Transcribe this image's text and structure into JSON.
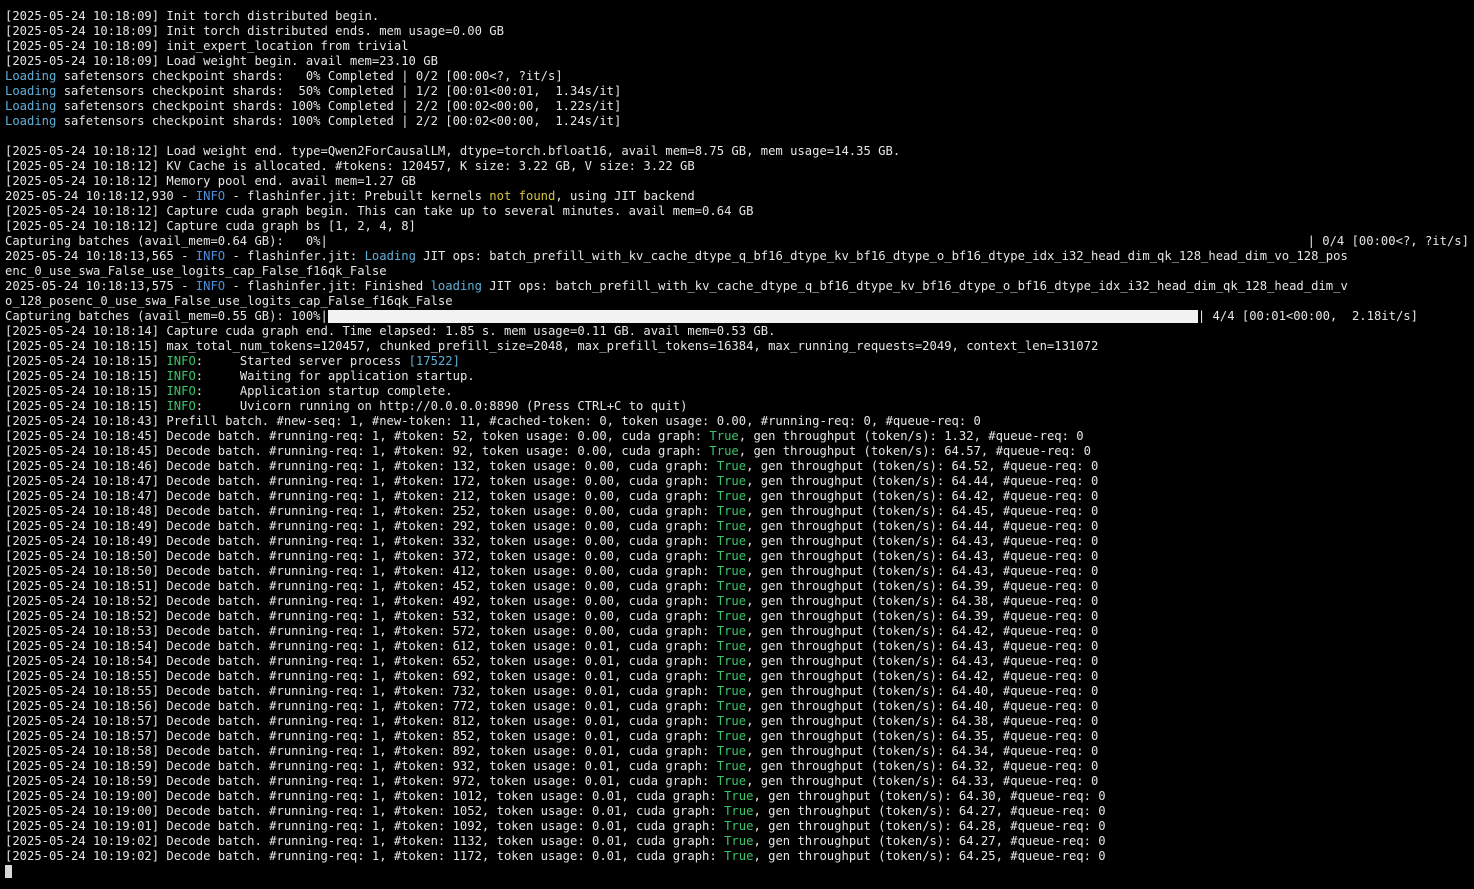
{
  "terminal": {
    "lines": [
      {
        "type": "text",
        "segs": [
          [
            "[2025-05-24 10:18:09] Init torch distributed begin.",
            ""
          ]
        ]
      },
      {
        "type": "text",
        "segs": [
          [
            "[2025-05-24 10:18:09] Init torch distributed ends. mem usage=0.00 GB",
            ""
          ]
        ]
      },
      {
        "type": "text",
        "segs": [
          [
            "[2025-05-24 10:18:09] init_expert_location from trivial",
            ""
          ]
        ]
      },
      {
        "type": "text",
        "segs": [
          [
            "[2025-05-24 10:18:09] Load weight begin. avail mem=23.10 GB",
            ""
          ]
        ]
      },
      {
        "type": "text",
        "segs": [
          [
            "Loading",
            "blue"
          ],
          [
            " safetensors checkpoint shards:   0% Completed | 0/2 [00:00<?, ?it/s]",
            ""
          ]
        ]
      },
      {
        "type": "text",
        "segs": [
          [
            "Loading",
            "blue"
          ],
          [
            " safetensors checkpoint shards:  50% Completed | 1/2 [00:01<00:01,  1.34s/it]",
            ""
          ]
        ]
      },
      {
        "type": "text",
        "segs": [
          [
            "Loading",
            "blue"
          ],
          [
            " safetensors checkpoint shards: 100% Completed | 2/2 [00:02<00:00,  1.22s/it]",
            ""
          ]
        ]
      },
      {
        "type": "text",
        "segs": [
          [
            "Loading",
            "blue"
          ],
          [
            " safetensors checkpoint shards: 100% Completed | 2/2 [00:02<00:00,  1.24s/it]",
            ""
          ]
        ]
      },
      {
        "type": "text",
        "segs": [
          [
            "",
            ""
          ]
        ]
      },
      {
        "type": "text",
        "segs": [
          [
            "[2025-05-24 10:18:12] Load weight end. type=Qwen2ForCausalLM, dtype=torch.bfloat16, avail mem=8.75 GB, mem usage=14.35 GB.",
            ""
          ]
        ]
      },
      {
        "type": "text",
        "segs": [
          [
            "[2025-05-24 10:18:12] KV Cache is allocated. #tokens: 120457, K size: 3.22 GB, V size: 3.22 GB",
            ""
          ]
        ]
      },
      {
        "type": "text",
        "segs": [
          [
            "[2025-05-24 10:18:12] Memory pool end. avail mem=1.27 GB",
            ""
          ]
        ]
      },
      {
        "type": "text",
        "segs": [
          [
            "2025-05-24 10:18:12,930 - ",
            ""
          ],
          [
            "INFO",
            "iblue"
          ],
          [
            " - flashinfer.jit: Prebuilt kernels ",
            ""
          ],
          [
            "not found",
            "yellow"
          ],
          [
            ", using JIT backend",
            ""
          ]
        ]
      },
      {
        "type": "text",
        "segs": [
          [
            "[2025-05-24 10:18:12] Capture cuda graph begin. This can take up to several minutes. avail mem=0.64 GB",
            ""
          ]
        ]
      },
      {
        "type": "text",
        "segs": [
          [
            "[2025-05-24 10:18:12] Capture cuda graph bs [1, 2, 4, 8]",
            ""
          ]
        ]
      },
      {
        "type": "progress",
        "left": "Capturing batches (avail_mem=0.64 GB):   0%|",
        "fraction": 0,
        "right": "| 0/4 [00:00<?, ?it/s]"
      },
      {
        "type": "text",
        "segs": [
          [
            "2025-05-24 10:18:13,565 - ",
            ""
          ],
          [
            "INFO",
            "iblue"
          ],
          [
            " - flashinfer.jit: ",
            ""
          ],
          [
            "Loading",
            "blue"
          ],
          [
            " JIT ops: batch_prefill_with_kv_cache_dtype_q_bf16_dtype_kv_bf16_dtype_o_bf16_dtype_idx_i32_head_dim_qk_128_head_dim_vo_128_pos",
            ""
          ]
        ]
      },
      {
        "type": "text",
        "segs": [
          [
            "enc_0_use_swa_False_use_logits_cap_False_f16qk_False",
            ""
          ]
        ]
      },
      {
        "type": "text",
        "segs": [
          [
            "2025-05-24 10:18:13,575 - ",
            ""
          ],
          [
            "INFO",
            "iblue"
          ],
          [
            " - flashinfer.jit: Finished ",
            ""
          ],
          [
            "loading",
            "blue"
          ],
          [
            " JIT ops: batch_prefill_with_kv_cache_dtype_q_bf16_dtype_kv_bf16_dtype_o_bf16_dtype_idx_i32_head_dim_qk_128_head_dim_v",
            ""
          ]
        ]
      },
      {
        "type": "text",
        "segs": [
          [
            "o_128_posenc_0_use_swa_False_use_logits_cap_False_f16qk_False",
            ""
          ]
        ]
      },
      {
        "type": "progress",
        "left": "Capturing batches (avail_mem=0.55 GB): 100%|",
        "fraction": 1,
        "right": "| 4/4 [00:01<00:00,  2.18it/s]"
      },
      {
        "type": "text",
        "segs": [
          [
            "[2025-05-24 10:18:14] Capture cuda graph end. Time elapsed: 1.85 s. mem usage=0.11 GB. avail mem=0.53 GB.",
            ""
          ]
        ]
      },
      {
        "type": "text",
        "segs": [
          [
            "[2025-05-24 10:18:15] max_total_num_tokens=120457, chunked_prefill_size=2048, max_prefill_tokens=16384, max_running_requests=2049, context_len=131072",
            ""
          ]
        ]
      },
      {
        "type": "text",
        "segs": [
          [
            "[2025-05-24 10:18:15] ",
            ""
          ],
          [
            "INFO",
            "green"
          ],
          [
            ":     Started server process ",
            ""
          ],
          [
            "[17522]",
            "blue"
          ]
        ]
      },
      {
        "type": "text",
        "segs": [
          [
            "[2025-05-24 10:18:15] ",
            ""
          ],
          [
            "INFO",
            "green"
          ],
          [
            ":     Waiting for application startup.",
            ""
          ]
        ]
      },
      {
        "type": "text",
        "segs": [
          [
            "[2025-05-24 10:18:15] ",
            ""
          ],
          [
            "INFO",
            "green"
          ],
          [
            ":     Application startup complete.",
            ""
          ]
        ]
      },
      {
        "type": "text",
        "segs": [
          [
            "[2025-05-24 10:18:15] ",
            ""
          ],
          [
            "INFO",
            "green"
          ],
          [
            ":     Uvicorn running on http://0.0.0.0:8890 (Press CTRL+C to quit)",
            ""
          ]
        ]
      },
      {
        "type": "text",
        "segs": [
          [
            "[2025-05-24 10:18:43] Prefill batch. #new-seq: 1, #new-token: 11, #cached-token: 0, token usage: 0.00, #running-req: 0, #queue-req: 0",
            ""
          ]
        ]
      },
      {
        "type": "text",
        "segs": [
          [
            "[2025-05-24 10:18:45] Decode batch. #running-req: 1, #token: 52, token usage: 0.00, cuda graph: ",
            ""
          ],
          [
            "True",
            "green"
          ],
          [
            ", gen throughput (token/s): 1.32, #queue-req: 0",
            ""
          ]
        ]
      },
      {
        "type": "text",
        "segs": [
          [
            "[2025-05-24 10:18:45] Decode batch. #running-req: 1, #token: 92, token usage: 0.00, cuda graph: ",
            ""
          ],
          [
            "True",
            "green"
          ],
          [
            ", gen throughput (token/s): 64.57, #queue-req: 0",
            ""
          ]
        ]
      },
      {
        "type": "text",
        "segs": [
          [
            "[2025-05-24 10:18:46] Decode batch. #running-req: 1, #token: 132, token usage: 0.00, cuda graph: ",
            ""
          ],
          [
            "True",
            "green"
          ],
          [
            ", gen throughput (token/s): 64.52, #queue-req: 0",
            ""
          ]
        ]
      },
      {
        "type": "text",
        "segs": [
          [
            "[2025-05-24 10:18:47] Decode batch. #running-req: 1, #token: 172, token usage: 0.00, cuda graph: ",
            ""
          ],
          [
            "True",
            "green"
          ],
          [
            ", gen throughput (token/s): 64.44, #queue-req: 0",
            ""
          ]
        ]
      },
      {
        "type": "text",
        "segs": [
          [
            "[2025-05-24 10:18:47] Decode batch. #running-req: 1, #token: 212, token usage: 0.00, cuda graph: ",
            ""
          ],
          [
            "True",
            "green"
          ],
          [
            ", gen throughput (token/s): 64.42, #queue-req: 0",
            ""
          ]
        ]
      },
      {
        "type": "text",
        "segs": [
          [
            "[2025-05-24 10:18:48] Decode batch. #running-req: 1, #token: 252, token usage: 0.00, cuda graph: ",
            ""
          ],
          [
            "True",
            "green"
          ],
          [
            ", gen throughput (token/s): 64.45, #queue-req: 0",
            ""
          ]
        ]
      },
      {
        "type": "text",
        "segs": [
          [
            "[2025-05-24 10:18:49] Decode batch. #running-req: 1, #token: 292, token usage: 0.00, cuda graph: ",
            ""
          ],
          [
            "True",
            "green"
          ],
          [
            ", gen throughput (token/s): 64.44, #queue-req: 0",
            ""
          ]
        ]
      },
      {
        "type": "text",
        "segs": [
          [
            "[2025-05-24 10:18:49] Decode batch. #running-req: 1, #token: 332, token usage: 0.00, cuda graph: ",
            ""
          ],
          [
            "True",
            "green"
          ],
          [
            ", gen throughput (token/s): 64.43, #queue-req: 0",
            ""
          ]
        ]
      },
      {
        "type": "text",
        "segs": [
          [
            "[2025-05-24 10:18:50] Decode batch. #running-req: 1, #token: 372, token usage: 0.00, cuda graph: ",
            ""
          ],
          [
            "True",
            "green"
          ],
          [
            ", gen throughput (token/s): 64.43, #queue-req: 0",
            ""
          ]
        ]
      },
      {
        "type": "text",
        "segs": [
          [
            "[2025-05-24 10:18:50] Decode batch. #running-req: 1, #token: 412, token usage: 0.00, cuda graph: ",
            ""
          ],
          [
            "True",
            "green"
          ],
          [
            ", gen throughput (token/s): 64.43, #queue-req: 0",
            ""
          ]
        ]
      },
      {
        "type": "text",
        "segs": [
          [
            "[2025-05-24 10:18:51] Decode batch. #running-req: 1, #token: 452, token usage: 0.00, cuda graph: ",
            ""
          ],
          [
            "True",
            "green"
          ],
          [
            ", gen throughput (token/s): 64.39, #queue-req: 0",
            ""
          ]
        ]
      },
      {
        "type": "text",
        "segs": [
          [
            "[2025-05-24 10:18:52] Decode batch. #running-req: 1, #token: 492, token usage: 0.00, cuda graph: ",
            ""
          ],
          [
            "True",
            "green"
          ],
          [
            ", gen throughput (token/s): 64.38, #queue-req: 0",
            ""
          ]
        ]
      },
      {
        "type": "text",
        "segs": [
          [
            "[2025-05-24 10:18:52] Decode batch. #running-req: 1, #token: 532, token usage: 0.00, cuda graph: ",
            ""
          ],
          [
            "True",
            "green"
          ],
          [
            ", gen throughput (token/s): 64.39, #queue-req: 0",
            ""
          ]
        ]
      },
      {
        "type": "text",
        "segs": [
          [
            "[2025-05-24 10:18:53] Decode batch. #running-req: 1, #token: 572, token usage: 0.00, cuda graph: ",
            ""
          ],
          [
            "True",
            "green"
          ],
          [
            ", gen throughput (token/s): 64.42, #queue-req: 0",
            ""
          ]
        ]
      },
      {
        "type": "text",
        "segs": [
          [
            "[2025-05-24 10:18:54] Decode batch. #running-req: 1, #token: 612, token usage: 0.01, cuda graph: ",
            ""
          ],
          [
            "True",
            "green"
          ],
          [
            ", gen throughput (token/s): 64.43, #queue-req: 0",
            ""
          ]
        ]
      },
      {
        "type": "text",
        "segs": [
          [
            "[2025-05-24 10:18:54] Decode batch. #running-req: 1, #token: 652, token usage: 0.01, cuda graph: ",
            ""
          ],
          [
            "True",
            "green"
          ],
          [
            ", gen throughput (token/s): 64.43, #queue-req: 0",
            ""
          ]
        ]
      },
      {
        "type": "text",
        "segs": [
          [
            "[2025-05-24 10:18:55] Decode batch. #running-req: 1, #token: 692, token usage: 0.01, cuda graph: ",
            ""
          ],
          [
            "True",
            "green"
          ],
          [
            ", gen throughput (token/s): 64.42, #queue-req: 0",
            ""
          ]
        ]
      },
      {
        "type": "text",
        "segs": [
          [
            "[2025-05-24 10:18:55] Decode batch. #running-req: 1, #token: 732, token usage: 0.01, cuda graph: ",
            ""
          ],
          [
            "True",
            "green"
          ],
          [
            ", gen throughput (token/s): 64.40, #queue-req: 0",
            ""
          ]
        ]
      },
      {
        "type": "text",
        "segs": [
          [
            "[2025-05-24 10:18:56] Decode batch. #running-req: 1, #token: 772, token usage: 0.01, cuda graph: ",
            ""
          ],
          [
            "True",
            "green"
          ],
          [
            ", gen throughput (token/s): 64.40, #queue-req: 0",
            ""
          ]
        ]
      },
      {
        "type": "text",
        "segs": [
          [
            "[2025-05-24 10:18:57] Decode batch. #running-req: 1, #token: 812, token usage: 0.01, cuda graph: ",
            ""
          ],
          [
            "True",
            "green"
          ],
          [
            ", gen throughput (token/s): 64.38, #queue-req: 0",
            ""
          ]
        ]
      },
      {
        "type": "text",
        "segs": [
          [
            "[2025-05-24 10:18:57] Decode batch. #running-req: 1, #token: 852, token usage: 0.01, cuda graph: ",
            ""
          ],
          [
            "True",
            "green"
          ],
          [
            ", gen throughput (token/s): 64.35, #queue-req: 0",
            ""
          ]
        ]
      },
      {
        "type": "text",
        "segs": [
          [
            "[2025-05-24 10:18:58] Decode batch. #running-req: 1, #token: 892, token usage: 0.01, cuda graph: ",
            ""
          ],
          [
            "True",
            "green"
          ],
          [
            ", gen throughput (token/s): 64.34, #queue-req: 0",
            ""
          ]
        ]
      },
      {
        "type": "text",
        "segs": [
          [
            "[2025-05-24 10:18:59] Decode batch. #running-req: 1, #token: 932, token usage: 0.01, cuda graph: ",
            ""
          ],
          [
            "True",
            "green"
          ],
          [
            ", gen throughput (token/s): 64.32, #queue-req: 0",
            ""
          ]
        ]
      },
      {
        "type": "text",
        "segs": [
          [
            "[2025-05-24 10:18:59] Decode batch. #running-req: 1, #token: 972, token usage: 0.01, cuda graph: ",
            ""
          ],
          [
            "True",
            "green"
          ],
          [
            ", gen throughput (token/s): 64.33, #queue-req: 0",
            ""
          ]
        ]
      },
      {
        "type": "text",
        "segs": [
          [
            "[2025-05-24 10:19:00] Decode batch. #running-req: 1, #token: 1012, token usage: 0.01, cuda graph: ",
            ""
          ],
          [
            "True",
            "green"
          ],
          [
            ", gen throughput (token/s): 64.30, #queue-req: 0",
            ""
          ]
        ]
      },
      {
        "type": "text",
        "segs": [
          [
            "[2025-05-24 10:19:00] Decode batch. #running-req: 1, #token: 1052, token usage: 0.01, cuda graph: ",
            ""
          ],
          [
            "True",
            "green"
          ],
          [
            ", gen throughput (token/s): 64.27, #queue-req: 0",
            ""
          ]
        ]
      },
      {
        "type": "text",
        "segs": [
          [
            "[2025-05-24 10:19:01] Decode batch. #running-req: 1, #token: 1092, token usage: 0.01, cuda graph: ",
            ""
          ],
          [
            "True",
            "green"
          ],
          [
            ", gen throughput (token/s): 64.28, #queue-req: 0",
            ""
          ]
        ]
      },
      {
        "type": "text",
        "segs": [
          [
            "[2025-05-24 10:19:02] Decode batch. #running-req: 1, #token: 1132, token usage: 0.01, cuda graph: ",
            ""
          ],
          [
            "True",
            "green"
          ],
          [
            ", gen throughput (token/s): 64.27, #queue-req: 0",
            ""
          ]
        ]
      },
      {
        "type": "text",
        "segs": [
          [
            "[2025-05-24 10:19:02] Decode batch. #running-req: 1, #token: 1172, token usage: 0.01, cuda graph: ",
            ""
          ],
          [
            "True",
            "green"
          ],
          [
            ", gen throughput (token/s): 64.25, #queue-req: 0",
            ""
          ]
        ]
      },
      {
        "type": "cursor"
      }
    ]
  }
}
